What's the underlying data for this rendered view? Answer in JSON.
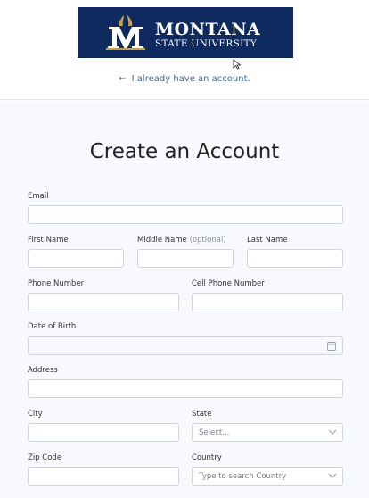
{
  "header": {
    "logo_line1": "MONTANA",
    "logo_line2": "STATE UNIVERSITY",
    "back_link": "I already have an account."
  },
  "form": {
    "title": "Create an Account",
    "email_label": "Email",
    "first_name_label": "First Name",
    "middle_name_label": "Middle Name",
    "middle_name_optional": "(optional)",
    "last_name_label": "Last Name",
    "phone_label": "Phone Number",
    "cell_phone_label": "Cell Phone Number",
    "dob_label": "Date of Birth",
    "address_label": "Address",
    "city_label": "City",
    "state_label": "State",
    "state_placeholder": "Select...",
    "zip_label": "Zip Code",
    "country_label": "Country",
    "country_placeholder": "Type to search Country"
  },
  "colors": {
    "brand_navy": "#0f2a5e",
    "brand_gold": "#c9a14a",
    "link": "#3d6b9e"
  }
}
